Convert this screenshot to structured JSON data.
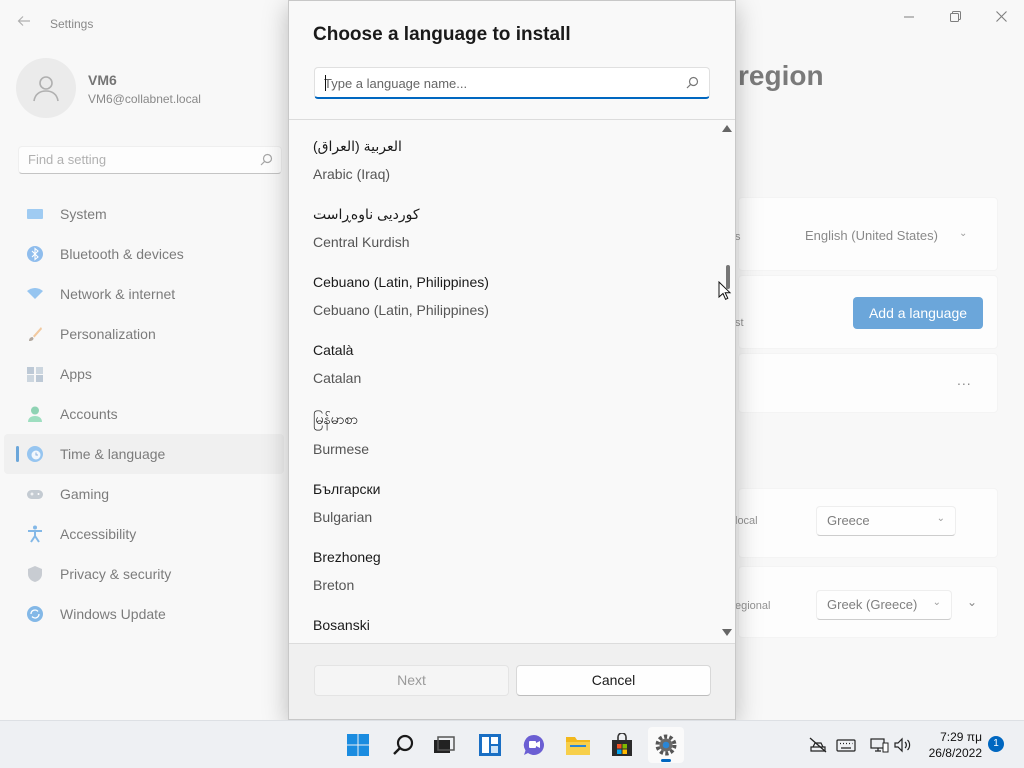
{
  "settings": {
    "app_title": "Settings",
    "user": {
      "name": "VM6",
      "email": "VM6@collabnet.local"
    },
    "search_placeholder": "Find a setting",
    "nav": [
      {
        "label": "System",
        "icon": "display-icon"
      },
      {
        "label": "Bluetooth & devices",
        "icon": "bluetooth-icon"
      },
      {
        "label": "Network & internet",
        "icon": "wifi-icon"
      },
      {
        "label": "Personalization",
        "icon": "brush-icon"
      },
      {
        "label": "Apps",
        "icon": "apps-icon"
      },
      {
        "label": "Accounts",
        "icon": "person-icon"
      },
      {
        "label": "Time & language",
        "icon": "globe-clock-icon",
        "active": true
      },
      {
        "label": "Gaming",
        "icon": "gamepad-icon"
      },
      {
        "label": "Accessibility",
        "icon": "accessibility-icon"
      },
      {
        "label": "Privacy & security",
        "icon": "shield-icon"
      },
      {
        "label": "Windows Update",
        "icon": "update-icon"
      }
    ],
    "page_title_fragment": "region",
    "display_language_value": "English (United States)",
    "display_language_label_fragment": "s",
    "add_language_label": "Add a language",
    "preferred_label_fragment": "st",
    "more_options_label": "...",
    "country_label_fragment": "local",
    "country_value": "Greece",
    "regional_format_label_fragment": "egional",
    "regional_format_value": "Greek (Greece)"
  },
  "dialog": {
    "title": "Choose a language to install",
    "search_placeholder": "Type a language name...",
    "languages": [
      {
        "native": "العربية (العراق)",
        "english": "Arabic (Iraq)"
      },
      {
        "native": "کوردیی ناوەڕاست",
        "english": "Central Kurdish"
      },
      {
        "native": "Cebuano (Latin, Philippines)",
        "english": "Cebuano (Latin, Philippines)"
      },
      {
        "native": "Català",
        "english": "Catalan"
      },
      {
        "native": "မြန်မာစာ",
        "english": "Burmese"
      },
      {
        "native": "Български",
        "english": "Bulgarian"
      },
      {
        "native": "Brezhoneg",
        "english": "Breton"
      },
      {
        "native": "Bosanski",
        "english": ""
      }
    ],
    "next_label": "Next",
    "cancel_label": "Cancel"
  },
  "taskbar": {
    "apps": [
      "start-icon",
      "search-icon",
      "task-view-icon",
      "widgets-icon",
      "chat-icon",
      "file-explorer-icon",
      "store-icon",
      "settings-icon"
    ],
    "time": "7:29 πμ",
    "date": "26/8/2022",
    "notification_count": "1"
  },
  "colors": {
    "accent": "#0067c0"
  }
}
